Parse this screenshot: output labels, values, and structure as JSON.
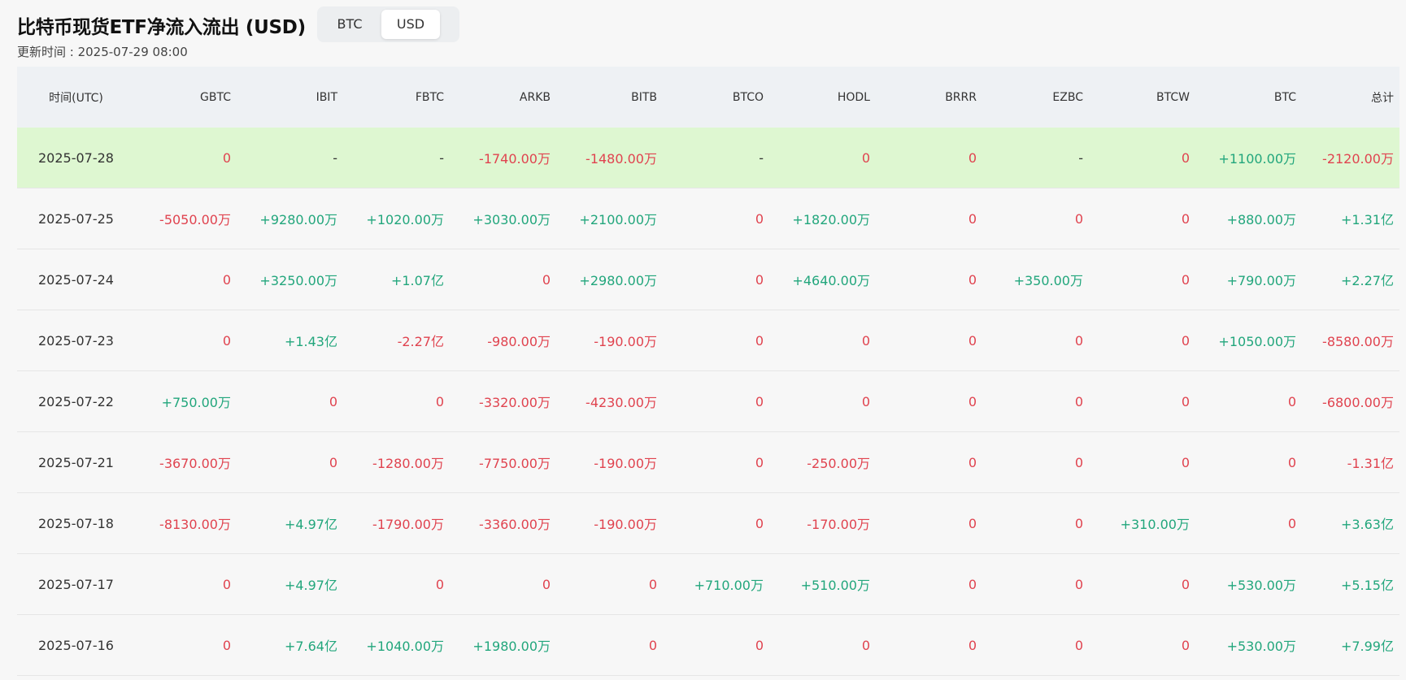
{
  "title": "比特币现货ETF净流入流出 (USD)",
  "updated": "更新时间 : 2025-07-29 08:00",
  "toggle": {
    "options": [
      "BTC",
      "USD"
    ],
    "selected": "USD"
  },
  "colors": {
    "negative": "#e0434f",
    "positive": "#22a67c",
    "highlight_row": "#def7d1",
    "header_bg": "#eef1f4"
  },
  "table": {
    "headers": [
      "时间(UTC)",
      "GBTC",
      "IBIT",
      "FBTC",
      "ARKB",
      "BITB",
      "BTCO",
      "HODL",
      "BRRR",
      "EZBC",
      "BTCW",
      "BTC",
      "总计"
    ],
    "rows": [
      {
        "date": "2025-07-28",
        "values": [
          "0",
          "-",
          "-",
          "-1740.00万",
          "-1480.00万",
          "-",
          "0",
          "0",
          "-",
          "0",
          "+1100.00万",
          "-2120.00万"
        ],
        "highlight": true
      },
      {
        "date": "2025-07-25",
        "values": [
          "-5050.00万",
          "+9280.00万",
          "+1020.00万",
          "+3030.00万",
          "+2100.00万",
          "0",
          "+1820.00万",
          "0",
          "0",
          "0",
          "+880.00万",
          "+1.31亿"
        ]
      },
      {
        "date": "2025-07-24",
        "values": [
          "0",
          "+3250.00万",
          "+1.07亿",
          "0",
          "+2980.00万",
          "0",
          "+4640.00万",
          "0",
          "+350.00万",
          "0",
          "+790.00万",
          "+2.27亿"
        ]
      },
      {
        "date": "2025-07-23",
        "values": [
          "0",
          "+1.43亿",
          "-2.27亿",
          "-980.00万",
          "-190.00万",
          "0",
          "0",
          "0",
          "0",
          "0",
          "+1050.00万",
          "-8580.00万"
        ]
      },
      {
        "date": "2025-07-22",
        "values": [
          "+750.00万",
          "0",
          "0",
          "-3320.00万",
          "-4230.00万",
          "0",
          "0",
          "0",
          "0",
          "0",
          "0",
          "-6800.00万"
        ]
      },
      {
        "date": "2025-07-21",
        "values": [
          "-3670.00万",
          "0",
          "-1280.00万",
          "-7750.00万",
          "-190.00万",
          "0",
          "-250.00万",
          "0",
          "0",
          "0",
          "0",
          "-1.31亿"
        ]
      },
      {
        "date": "2025-07-18",
        "values": [
          "-8130.00万",
          "+4.97亿",
          "-1790.00万",
          "-3360.00万",
          "-190.00万",
          "0",
          "-170.00万",
          "0",
          "0",
          "+310.00万",
          "0",
          "+3.63亿"
        ]
      },
      {
        "date": "2025-07-17",
        "values": [
          "0",
          "+4.97亿",
          "0",
          "0",
          "0",
          "+710.00万",
          "+510.00万",
          "0",
          "0",
          "0",
          "+530.00万",
          "+5.15亿"
        ]
      },
      {
        "date": "2025-07-16",
        "values": [
          "0",
          "+7.64亿",
          "+1040.00万",
          "+1980.00万",
          "0",
          "0",
          "0",
          "0",
          "0",
          "0",
          "+530.00万",
          "+7.99亿"
        ]
      }
    ]
  }
}
